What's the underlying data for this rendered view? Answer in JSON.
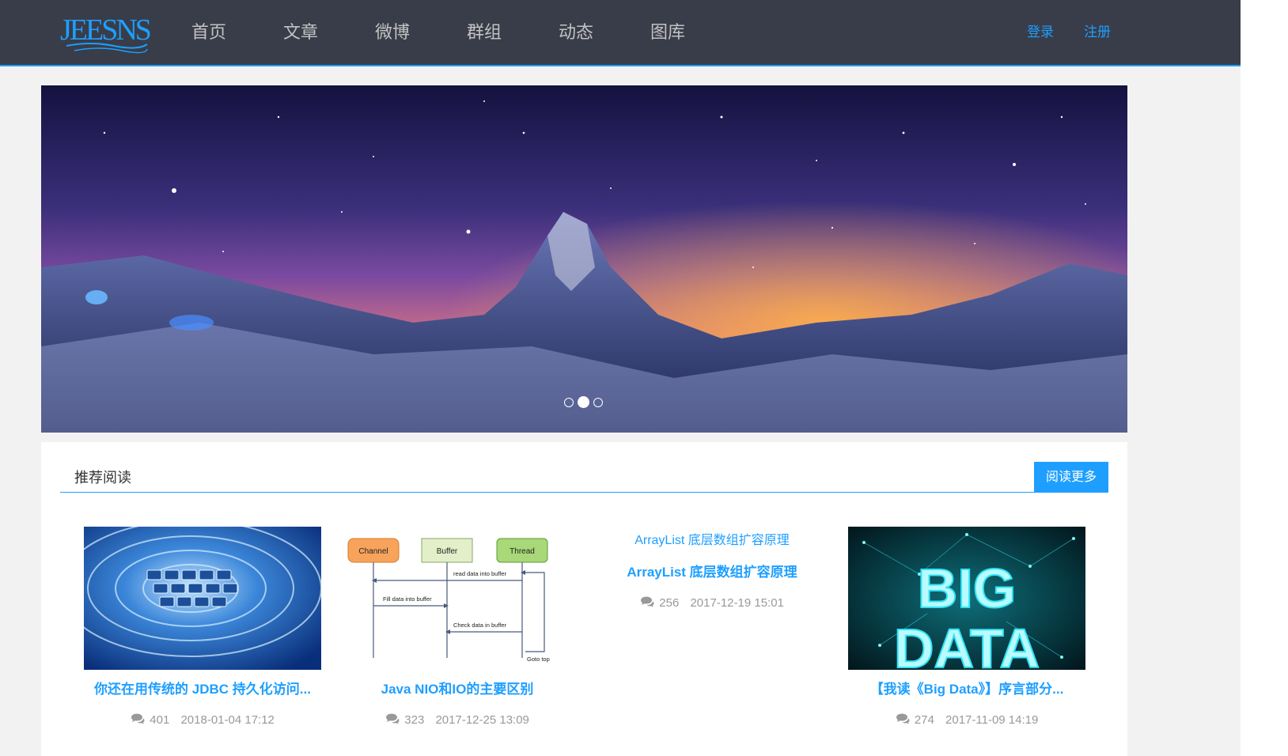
{
  "header": {
    "logo_text": "JEESNS",
    "nav": [
      "首页",
      "文章",
      "微博",
      "群组",
      "动态",
      "图库"
    ],
    "login": "登录",
    "register": "注册",
    "accent": "#1e9fff",
    "bg": "#393d49"
  },
  "carousel": {
    "slide_count": 3,
    "active_index": 1
  },
  "recommend": {
    "title": "推荐阅读",
    "more_button": "阅读更多",
    "articles": [
      {
        "title": "你还在用传统的 JDBC 持久化访问...",
        "comments": "401",
        "date": "2018-01-04 17:12",
        "image": "keyboard-water-image"
      },
      {
        "title": "Java NIO和IO的主要区别",
        "comments": "323",
        "date": "2017-12-25 13:09",
        "image": "nio-sequence-diagram",
        "diagram": {
          "actors": [
            "Channel",
            "Buffer",
            "Thread"
          ],
          "messages": [
            "read data into buffer",
            "Fill data into buffer",
            "Check data in buffer",
            "Goto top"
          ]
        }
      },
      {
        "summary": "ArrayList 底层数组扩容原理",
        "title": "ArrayList 底层数组扩容原理",
        "comments": "256",
        "date": "2017-12-19 15:01"
      },
      {
        "title": "【我读《Big Data》】序言部分...",
        "comments": "274",
        "date": "2017-11-09 14:19",
        "image": "big-data-image",
        "image_text": [
          "BIG",
          "DATA"
        ]
      }
    ]
  }
}
